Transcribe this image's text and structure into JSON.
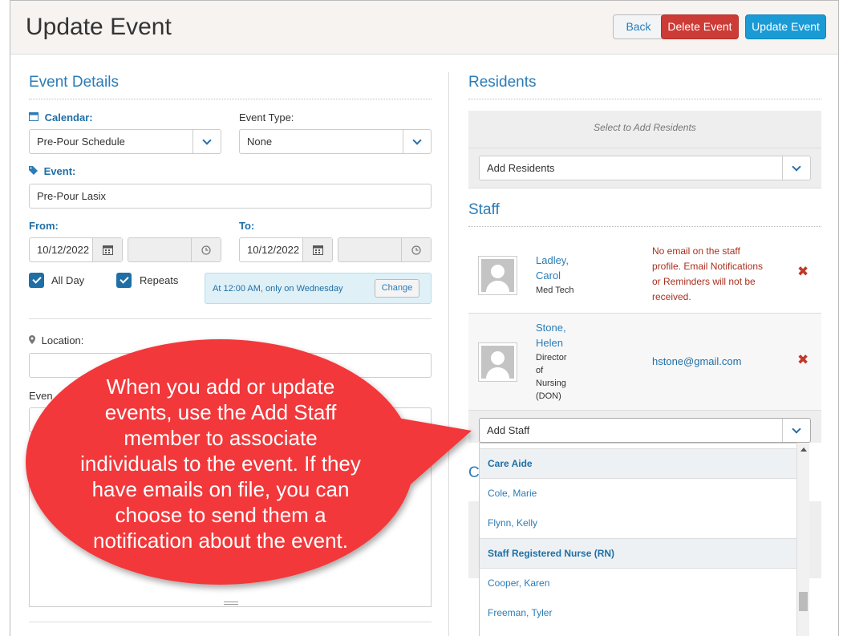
{
  "header": {
    "title": "Update Event",
    "back_label": "Back",
    "delete_label": "Delete Event",
    "update_label": "Update Event"
  },
  "event_details": {
    "section_title": "Event Details",
    "calendar_label": "Calendar:",
    "calendar_value": "Pre-Pour Schedule",
    "event_type_label": "Event Type:",
    "event_type_value": "None",
    "event_label": "Event:",
    "event_value": "Pre-Pour Lasix",
    "from_label": "From:",
    "from_date": "10/12/2022",
    "to_label": "To:",
    "to_date": "10/12/2022",
    "all_day_label": "All Day",
    "repeats_label": "Repeats",
    "repeat_summary": "At 12:00 AM, only on Wednesday",
    "change_label": "Change",
    "location_label": "Location:",
    "partial_label": "Even"
  },
  "residents": {
    "section_title": "Residents",
    "hint": "Select to Add Residents",
    "add_placeholder": "Add Residents"
  },
  "staff": {
    "section_title": "Staff",
    "members": [
      {
        "last": "Ladley,",
        "first": "Carol",
        "role": "Med Tech",
        "note_lines": [
          "No email on the staff",
          "profile. Email Notifications",
          "or Reminders will not be",
          "received."
        ]
      },
      {
        "last": "Stone,",
        "first": "Helen",
        "role_lines": [
          "Director",
          "of",
          "Nursing",
          "(DON)"
        ],
        "email": "hstone@gmail.com"
      }
    ],
    "add_placeholder": "Add Staff",
    "dropdown": [
      {
        "group": "Care Aide",
        "items": [
          "Cole, Marie",
          "Flynn, Kelly"
        ]
      },
      {
        "group": "Staff Registered Nurse (RN)",
        "items": [
          "Cooper, Karen",
          "Freeman, Tyler"
        ]
      }
    ],
    "partial_section_letter": "C"
  },
  "callout": {
    "lines": [
      "When you add or update",
      "events, use the Add Staff",
      "member to associate",
      "individuals to the event. If they",
      "have emails on file, you can",
      "choose to send them a",
      "notification about the event."
    ],
    "fill_color": "#f2393b"
  },
  "colors": {
    "accent": "#2a7cb7",
    "danger": "#cc3b36",
    "primary": "#1a9bd6"
  }
}
